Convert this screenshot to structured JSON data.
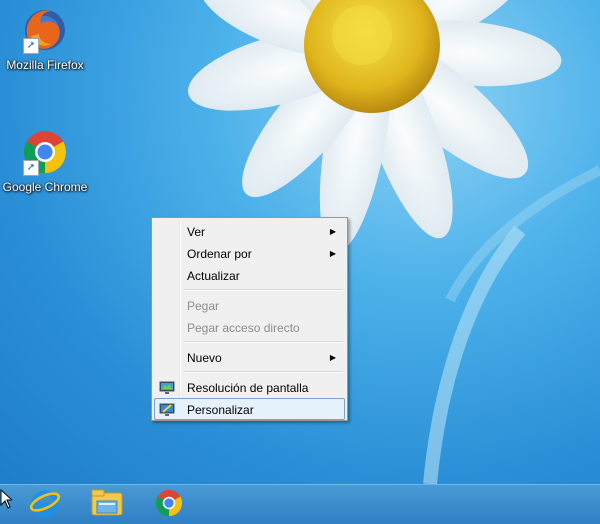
{
  "desktop": {
    "icons": [
      {
        "label": "Mozilla Firefox",
        "icon": "firefox-icon"
      },
      {
        "label": "Google Chrome",
        "icon": "chrome-icon"
      }
    ]
  },
  "context_menu": {
    "items": [
      {
        "label": "Ver",
        "submenu": true,
        "enabled": true
      },
      {
        "label": "Ordenar por",
        "submenu": true,
        "enabled": true
      },
      {
        "label": "Actualizar",
        "submenu": false,
        "enabled": true
      },
      {
        "label": "Pegar",
        "submenu": false,
        "enabled": false
      },
      {
        "label": "Pegar acceso directo",
        "submenu": false,
        "enabled": false
      },
      {
        "label": "Nuevo",
        "submenu": true,
        "enabled": true
      },
      {
        "label": "Resolución de pantalla",
        "submenu": false,
        "enabled": true,
        "icon": "display-resolution-icon"
      },
      {
        "label": "Personalizar",
        "submenu": false,
        "enabled": true,
        "icon": "personalize-icon",
        "highlighted": true
      }
    ]
  },
  "taskbar": {
    "pinned": [
      "internet-explorer-icon",
      "file-explorer-icon",
      "chrome-icon"
    ]
  },
  "colors": {
    "wallpaper": "#2a8fd6",
    "taskbar": "#3a8bcc",
    "menu_bg": "#f0f0f0",
    "menu_highlight": "#e5f1fb"
  }
}
